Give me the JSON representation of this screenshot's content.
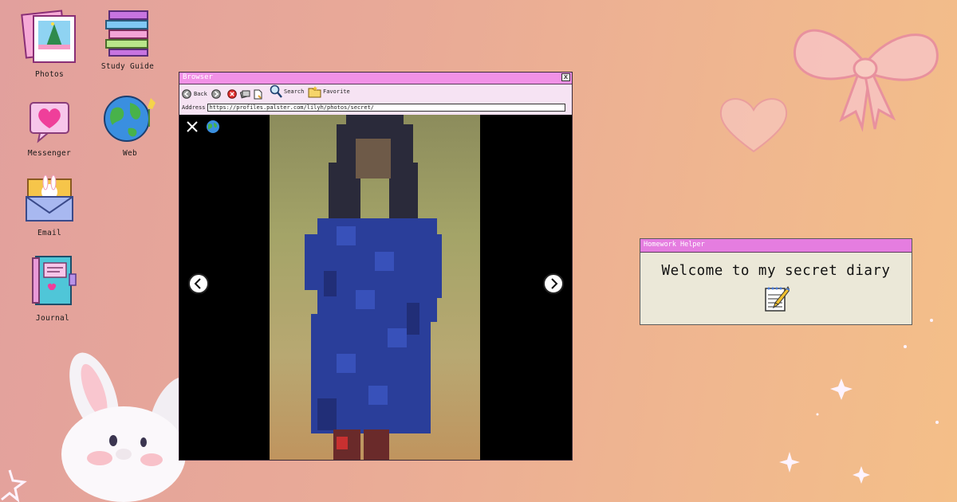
{
  "desktop": {
    "icons": [
      {
        "label": "Photos",
        "icon": "photos-icon"
      },
      {
        "label": "Study Guide",
        "icon": "books-icon"
      },
      {
        "label": "Messenger",
        "icon": "heart-message-icon"
      },
      {
        "label": "Web",
        "icon": "globe-icon"
      },
      {
        "label": "Email",
        "icon": "envelope-icon"
      },
      {
        "label": "Journal",
        "icon": "journal-icon"
      }
    ]
  },
  "browser": {
    "title": "Browser",
    "close_label": "x",
    "toolbar": {
      "back_label": "Back",
      "search_label": "Search",
      "favorite_label": "Favorite",
      "address_label": "Address",
      "address_value": "https://profiles.palster.com/lilyh/photos/secret/"
    },
    "viewer": {
      "close_icon": "close-icon",
      "globe_icon": "globe-icon"
    }
  },
  "homework_helper": {
    "title": "Homework Helper",
    "message": "Welcome to my secret diary",
    "icon": "notepad-pencil-icon"
  },
  "colors": {
    "titlebar_pink": "#f191e6",
    "toolbar_bg": "#f6e3f3",
    "desktop_left": "#e2a09d",
    "desktop_right": "#f4bf88"
  }
}
